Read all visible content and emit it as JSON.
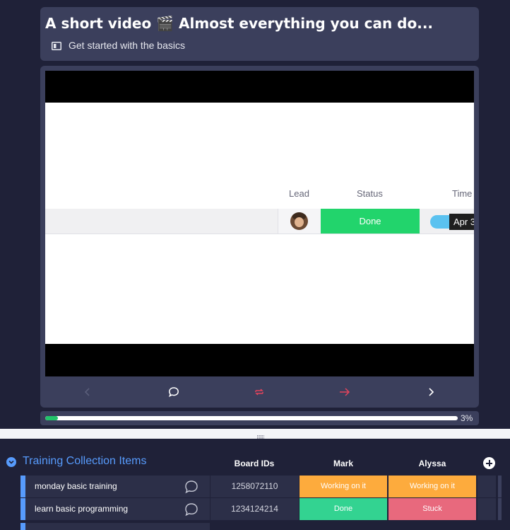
{
  "header": {
    "title": "A short video 🎬 Almost everything you can do...",
    "subtitle": "Get started with the basics",
    "subtitle_icon": "layout-icon"
  },
  "video": {
    "columns": {
      "lead": "Lead",
      "status": "Status",
      "timeline": "Time"
    },
    "row": {
      "status": "Done",
      "timeline_date": "Apr 3"
    },
    "colors": {
      "done": "#22d46c",
      "timeline": "#5bc2f0"
    }
  },
  "controls": {
    "prev": "chevron-left-icon",
    "comment": "comment-icon",
    "repeat": "repeat-icon",
    "next_item": "arrow-right-icon",
    "next": "chevron-right-icon",
    "accent": "#e2445c"
  },
  "progress": {
    "percent_label": "3%",
    "fraction": 0.03
  },
  "board": {
    "group_title": "Training Collection Items",
    "group_color": "#579bfc",
    "columns": [
      "Board IDs",
      "Mark",
      "Alyssa"
    ],
    "rows": [
      {
        "name": "monday basic training",
        "board_id": "1258072110",
        "mark": "Working on it",
        "alyssa": "Working on it"
      },
      {
        "name": "learn basic programming",
        "board_id": "1234124214",
        "mark": "Done",
        "alyssa": "Stuck"
      }
    ],
    "status_colors": {
      "Working on it": "#fdab3d",
      "Done": "#33d391",
      "Stuck": "#e8697d"
    }
  }
}
